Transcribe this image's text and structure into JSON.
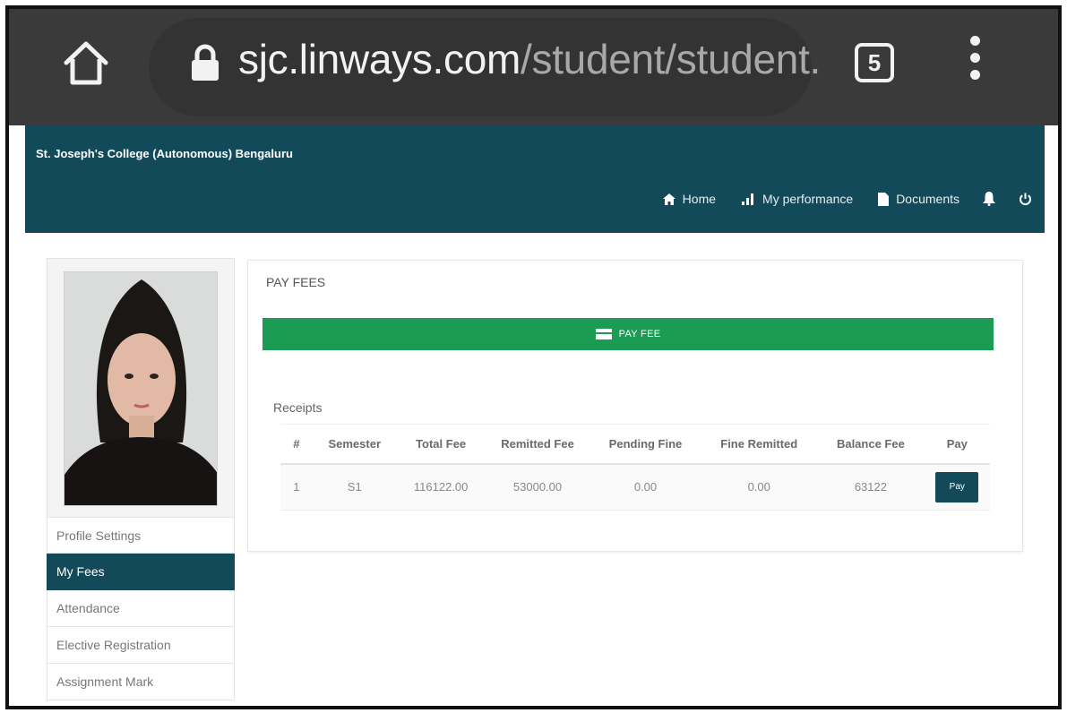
{
  "browser": {
    "url_host": "sjc.linways.com",
    "url_path": "/student/student.",
    "tab_count": "5"
  },
  "header": {
    "college_name": "St. Joseph's College (Autonomous) Bengaluru",
    "nav": {
      "home": "Home",
      "performance": "My performance",
      "documents": "Documents"
    }
  },
  "sidebar": {
    "items": [
      {
        "label": "Profile Settings"
      },
      {
        "label": "My Fees"
      },
      {
        "label": "Attendance"
      },
      {
        "label": "Elective Registration"
      },
      {
        "label": "Assignment Mark"
      }
    ],
    "active_index": 1
  },
  "main": {
    "title": "PAY FEES",
    "pay_fee_label": "PAY FEE",
    "receipts_label": "Receipts",
    "table": {
      "headers": [
        "#",
        "Semester",
        "Total Fee",
        "Remitted Fee",
        "Pending Fine",
        "Fine Remitted",
        "Balance Fee",
        "Pay"
      ],
      "rows": [
        {
          "num": "1",
          "semester": "S1",
          "total_fee": "116122.00",
          "remitted_fee": "53000.00",
          "pending_fine": "0.00",
          "fine_remitted": "0.00",
          "balance_fee": "63122",
          "pay_label": "Pay"
        }
      ]
    }
  },
  "colors": {
    "chrome": "#3a3a3a",
    "header": "#134a5a",
    "pay_fee_bar": "#1c9b55"
  }
}
